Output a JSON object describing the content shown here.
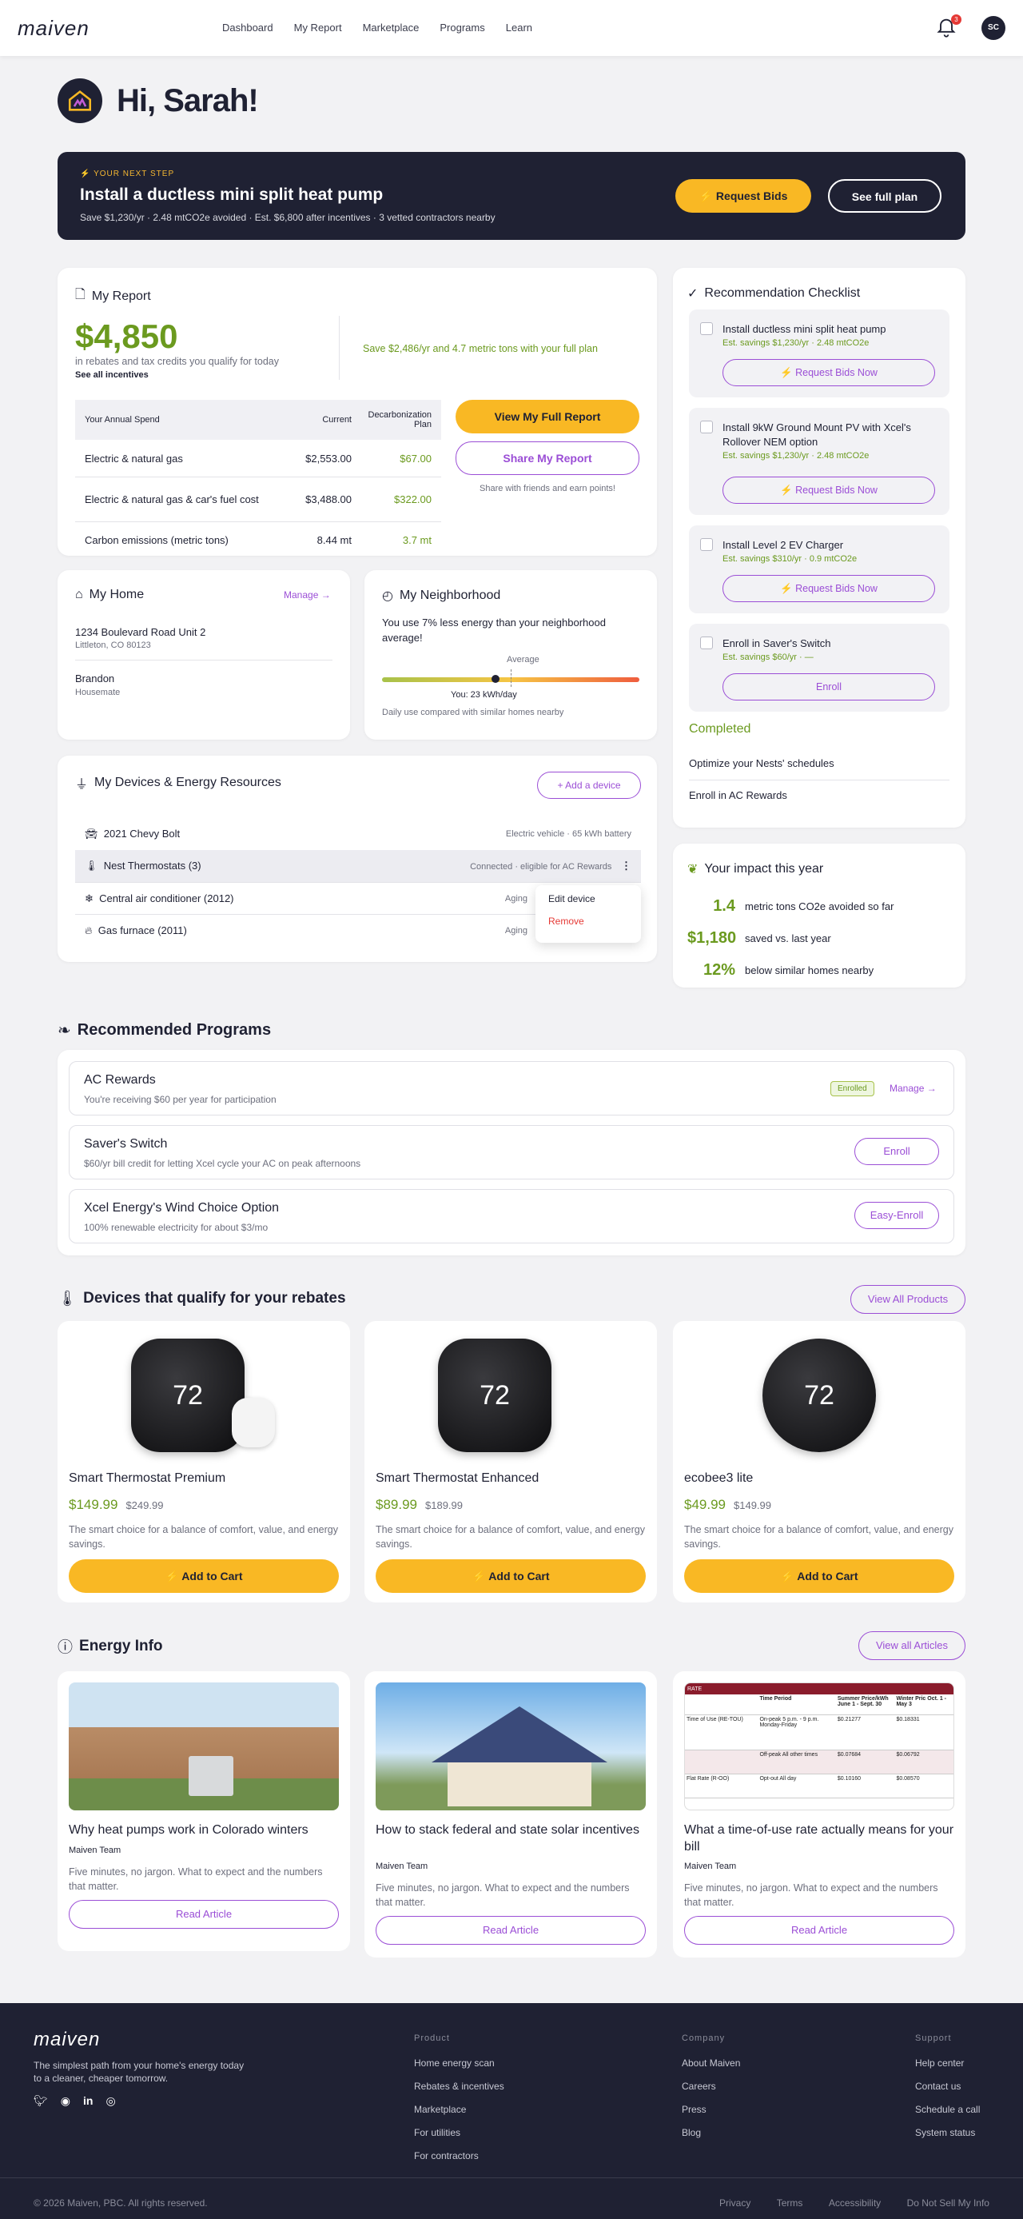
{
  "nav": {
    "logo": "maiven",
    "items": [
      "Dashboard",
      "My Report",
      "Marketplace",
      "Programs",
      "Learn"
    ],
    "notif_count": "3",
    "avatar": "SC"
  },
  "greeting": "Hi, Sarah!",
  "hero": {
    "tag": "YOUR NEXT STEP",
    "title": "Install a ductless mini split heat pump",
    "sub": "Save $1,230/yr  ·  2.48 mtCO2e avoided  ·  Est. $6,800 after incentives  ·  3 vetted contractors nearby",
    "btn1": "Request Bids",
    "btn2": "See full plan"
  },
  "report": {
    "title": "My Report",
    "amount": "$4,850",
    "amount_sub": "in rebates and tax credits you qualify for today",
    "see_all": "See all incentives",
    "save_text": "Save $2,486/yr and 4.7 metric tons with your full plan",
    "headers": [
      "Your Annual Spend",
      "Current",
      "Decarbonization Plan"
    ],
    "rows": [
      [
        "Electric & natural gas",
        "$2,553.00",
        "$67.00"
      ],
      [
        "Electric & natural gas & car's fuel cost",
        "$3,488.00",
        "$322.00"
      ],
      [
        "Carbon emissions (metric tons)",
        "8.44 mt",
        "3.7 mt"
      ]
    ],
    "btn_full": "View My Full Report",
    "btn_share": "Share My Report",
    "share_note": "Share with friends and earn points!"
  },
  "checklist": {
    "title": "Recommendation Checklist",
    "items": [
      {
        "title": "Install ductless mini split heat pump",
        "meta": "Est. savings $1,230/yr  ·  2.48 mtCO2e",
        "btn": "Request Bids Now"
      },
      {
        "title": "Install 9kW Ground Mount PV with Xcel's Rollover NEM option",
        "meta": "Est. savings $1,230/yr  ·  2.48 mtCO2e",
        "btn": "Request Bids Now"
      },
      {
        "title": "Install Level 2 EV Charger",
        "meta": "Est. savings $310/yr  ·  0.9 mtCO2e",
        "btn": "Request Bids Now"
      },
      {
        "title": "Enroll in Saver's Switch",
        "meta": "Est. savings $60/yr  ·  —",
        "btn": "Enroll"
      }
    ],
    "completed_label": "Completed",
    "completed": [
      "Optimize your Nests' schedules",
      "Enroll in AC Rewards"
    ]
  },
  "home": {
    "title": "My Home",
    "manage": "Manage →",
    "address": "1234 Boulevard Road Unit 2",
    "city": "Littleton, CO 80123",
    "owner": "Brandon",
    "role": "Housemate"
  },
  "neighborhood": {
    "title": "My Neighborhood",
    "text": "You use 7% less energy than your neighborhood average!",
    "avg_label": "Average",
    "you_label": "You: 23 kWh/day",
    "you_pos": 0.44,
    "avg_pos": 0.5,
    "note": "Daily use compared with similar homes nearby"
  },
  "impact": {
    "title": "Your impact this year",
    "items": [
      [
        "1.4",
        "metric tons CO2e avoided so far"
      ],
      [
        "$1,180",
        "saved vs. last year"
      ],
      [
        "12%",
        "below similar homes nearby"
      ]
    ]
  },
  "devices": {
    "title": "My Devices & Energy Resources",
    "add": "+ Add a device",
    "items": [
      {
        "name": "2021 Chevy Bolt",
        "meta": "Electric vehicle  ·  65 kWh battery"
      },
      {
        "name": "Nest Thermostats (3)",
        "meta": "Connected  ·  eligible for AC Rewards"
      },
      {
        "name": "Central air conditioner (2012)",
        "meta": "Aging"
      },
      {
        "name": "Gas furnace (2011)",
        "meta": "Aging"
      }
    ],
    "menu": [
      "Edit device",
      "Remove"
    ]
  },
  "programs": {
    "title": "Recommended Programs",
    "items": [
      {
        "name": "AC Rewards",
        "desc": "You're receiving $60 per year for participation",
        "badge": "Enrolled",
        "action": "Manage →"
      },
      {
        "name": "Saver's Switch",
        "desc": "$60/yr bill credit for letting Xcel cycle your AC on peak afternoons",
        "action": "Enroll"
      },
      {
        "name": "Xcel Energy's Wind Choice Option",
        "desc": "100% renewable electricity for about $3/mo",
        "action": "Easy-Enroll"
      }
    ]
  },
  "products": {
    "title": "Devices that qualify for your rebates",
    "view_all": "View All Products",
    "items": [
      {
        "name": "Smart Thermostat Premium",
        "price": "$149.99",
        "old": "$249.99",
        "desc": "The smart choice for a balance of comfort, value, and energy savings.",
        "btn": "Add to Cart",
        "temp": "72"
      },
      {
        "name": "Smart Thermostat Enhanced",
        "price": "$89.99",
        "old": "$189.99",
        "desc": "The smart choice for a balance of comfort, value, and energy savings.",
        "btn": "Add to Cart",
        "temp": "72"
      },
      {
        "name": "ecobee3 lite",
        "price": "$49.99",
        "old": "$149.99",
        "desc": "The smart choice for a balance of comfort, value, and energy savings.",
        "btn": "Add to Cart",
        "temp": "72"
      }
    ]
  },
  "articles": {
    "title": "Energy Info",
    "view_all": "View all Articles",
    "items": [
      {
        "title": "Why heat pumps work in Colorado winters",
        "author": "Maiven Team",
        "desc": "Five minutes, no jargon. What to expect and the numbers that matter.",
        "btn": "Read Article"
      },
      {
        "title": "How to stack federal and state solar incentives",
        "author": "Maiven Team",
        "desc": "Five minutes, no jargon. What to expect and the numbers that matter.",
        "btn": "Read Article"
      },
      {
        "title": "What a time-of-use rate actually means for your bill",
        "author": "Maiven Team",
        "desc": "Five minutes, no jargon. What to expect and the numbers that matter.",
        "btn": "Read Article"
      }
    ],
    "rate_table": {
      "head": [
        "RATE",
        "Time Period",
        "Summer Price/kWh June 1 - Sept. 30",
        "Winter Pric Oct. 1 - May 3"
      ],
      "rows": [
        [
          "Time of Use (RE-TOU)",
          "On-peak 5 p.m. - 9 p.m. Monday-Friday",
          "$0.21277",
          "$0.18331"
        ],
        [
          "",
          "Off-peak All other times",
          "$0.07684",
          "$0.06792"
        ],
        [
          "Flat Rate (R-OO)",
          "Opt-out All day",
          "$0.10160",
          "$0.08570"
        ]
      ]
    }
  },
  "footer": {
    "logo": "maiven",
    "tagline": "The simplest path from your home's energy today to a cleaner, cheaper tomorrow.",
    "cols": [
      {
        "head": "Product",
        "items": [
          "Home energy scan",
          "Rebates & incentives",
          "Marketplace",
          "For utilities",
          "For contractors"
        ]
      },
      {
        "head": "Company",
        "items": [
          "About Maiven",
          "Careers",
          "Press",
          "Blog"
        ]
      },
      {
        "head": "Support",
        "items": [
          "Help center",
          "Contact us",
          "Schedule a call",
          "System status"
        ]
      }
    ],
    "copyright": "© 2026 Maiven, PBC. All rights reserved.",
    "legal": [
      "Privacy",
      "Terms",
      "Accessibility",
      "Do Not Sell My Info"
    ]
  },
  "colors": {
    "accent": "#9b4ed6",
    "brand_yellow": "#f9b824",
    "dark": "#1f2133",
    "green": "#6b9a1f"
  }
}
